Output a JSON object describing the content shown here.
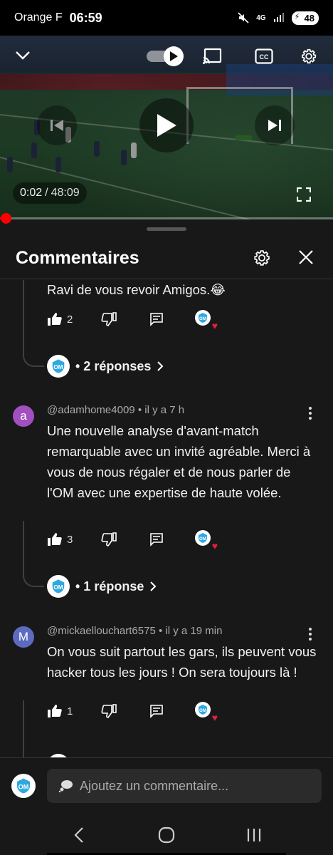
{
  "status_bar": {
    "carrier": "Orange F",
    "time": "06:59",
    "network": "4G",
    "battery": "48"
  },
  "player": {
    "current_time": "0:02",
    "separator": "/",
    "duration": "48:09",
    "progress_fraction": 0.002,
    "accent": "#ff0000"
  },
  "comments_panel": {
    "title": "Commentaires",
    "threads": [
      {
        "partial": true,
        "text": "Ravi de vous revoir Amigos.😂",
        "likes": "2",
        "replies_label": "• 2 réponses"
      },
      {
        "avatar_letter": "a",
        "avatar_color": "#a24fc0",
        "author": "@adamhome4009",
        "age": "• il y a 7 h",
        "text": "Une nouvelle analyse d'avant-match remarquable avec un invité agréable. Merci à vous de nous régaler et de nous parler de l'OM avec une expertise de haute volée.",
        "likes": "3",
        "replies_label": "• 1 réponse"
      },
      {
        "avatar_letter": "M",
        "avatar_color": "#5c6bc0",
        "author": "@mickaellouchart6575",
        "age": "• il y a 19 min",
        "text": "On vous suit partout les gars, ils peuvent vous hacker tous les jours ! On sera toujours là !",
        "likes": "1"
      }
    ]
  },
  "composer": {
    "placeholder": "Ajoutez un commentaire..."
  },
  "icons": {
    "like": "thumb-up-icon",
    "dislike": "thumb-down-icon",
    "reply": "reply-icon",
    "creator_heart": "creator-heart-icon"
  }
}
